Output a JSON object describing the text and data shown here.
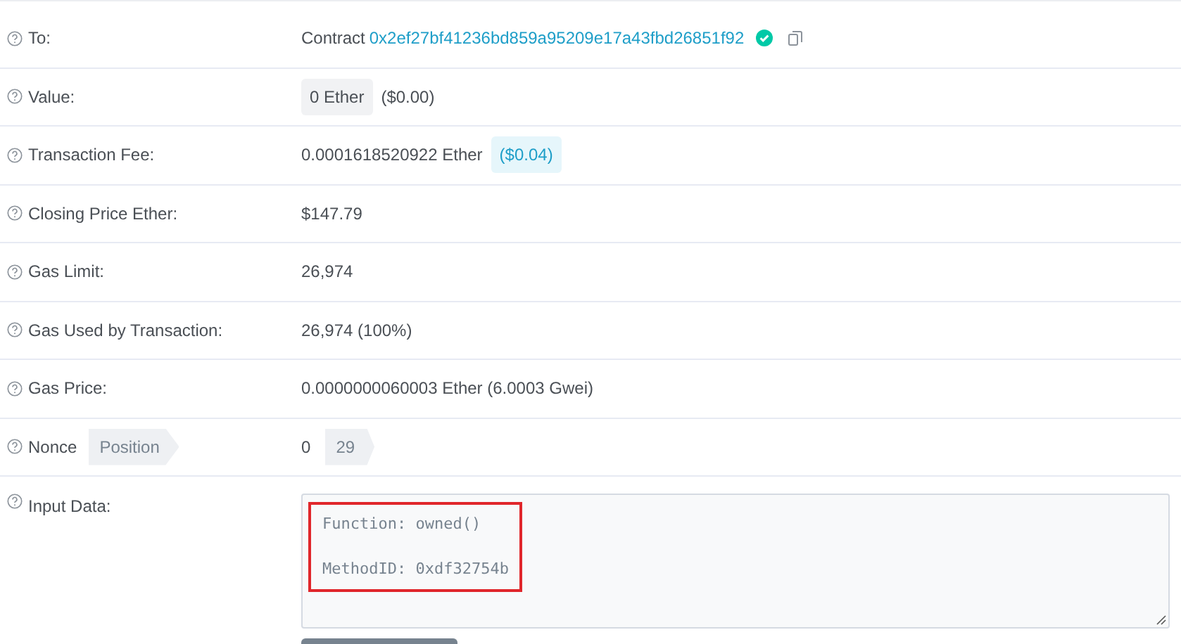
{
  "rows": [
    {
      "kind": "address",
      "label": "To:",
      "prefix": "Contract",
      "address": "0x2ef27bf41236bd859a95209e17a43fbd26851f92",
      "verified": true
    },
    {
      "kind": "pill",
      "label": "Value:",
      "pill": "0 Ether",
      "text": "($0.00)"
    },
    {
      "kind": "fee",
      "label": "Transaction Fee:",
      "text": "0.0001618520922 Ether",
      "pill": "($0.04)"
    },
    {
      "kind": "text",
      "label": "Closing Price Ether:",
      "text": "$147.79"
    },
    {
      "kind": "text",
      "label": "Gas Limit:",
      "text": "26,974"
    },
    {
      "kind": "text",
      "label": "Gas Used by Transaction:",
      "text": "26,974 (100%)"
    },
    {
      "kind": "text",
      "label": "Gas Price:",
      "text": "0.0000000060003 Ether (6.0003 Gwei)"
    },
    {
      "kind": "nonce",
      "label": "Nonce",
      "tag": "Position",
      "text": "0",
      "pill": "29"
    }
  ],
  "input_data": {
    "label": "Input Data:",
    "lines": [
      "Function: owned()",
      "MethodID: 0xdf32754b"
    ],
    "highlighted": true
  }
}
